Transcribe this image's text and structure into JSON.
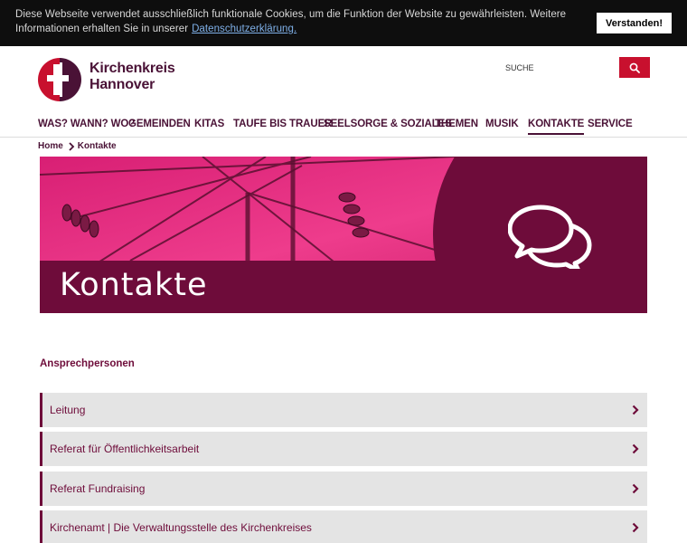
{
  "cookie": {
    "text": "Diese Webseite verwendet ausschließlich funktionale Cookies, um die Funktion der Website zu gewährleisten. Weitere Informationen erhalten Sie in unserer",
    "link_label": "Datenschutzerklärung.",
    "accept_label": "Verstanden!"
  },
  "logo": {
    "line1": "Kirchenkreis",
    "line2": "Hannover"
  },
  "search": {
    "placeholder": "SUCHE"
  },
  "nav": {
    "items": [
      {
        "label": "WAS? WANN? WO?"
      },
      {
        "label": "GEMEINDEN"
      },
      {
        "label": "KITAS"
      },
      {
        "label": "TAUFE BIS TRAUER"
      },
      {
        "label": "SEELSORGE & SOZIALES"
      },
      {
        "label": "THEMEN"
      },
      {
        "label": "MUSIK"
      },
      {
        "label": "KONTAKTE"
      },
      {
        "label": "SERVICE"
      }
    ],
    "active": "KONTAKTE"
  },
  "breadcrumb": {
    "home": "Home",
    "current": "Kontakte"
  },
  "hero": {
    "title": "Kontakte",
    "icon": "speech-bubbles-icon"
  },
  "content": {
    "heading": "Ansprechpersonen",
    "items": [
      {
        "label": "Leitung"
      },
      {
        "label": "Referat für Öffentlichkeitsarbeit"
      },
      {
        "label": "Referat Fundraising"
      },
      {
        "label": "Kirchenamt | Die Verwaltungsstelle des Kirchenkreises"
      }
    ]
  },
  "colors": {
    "brand": "#6e0c3a",
    "accent": "#c8102e",
    "hero_magenta": "#e0217a"
  }
}
